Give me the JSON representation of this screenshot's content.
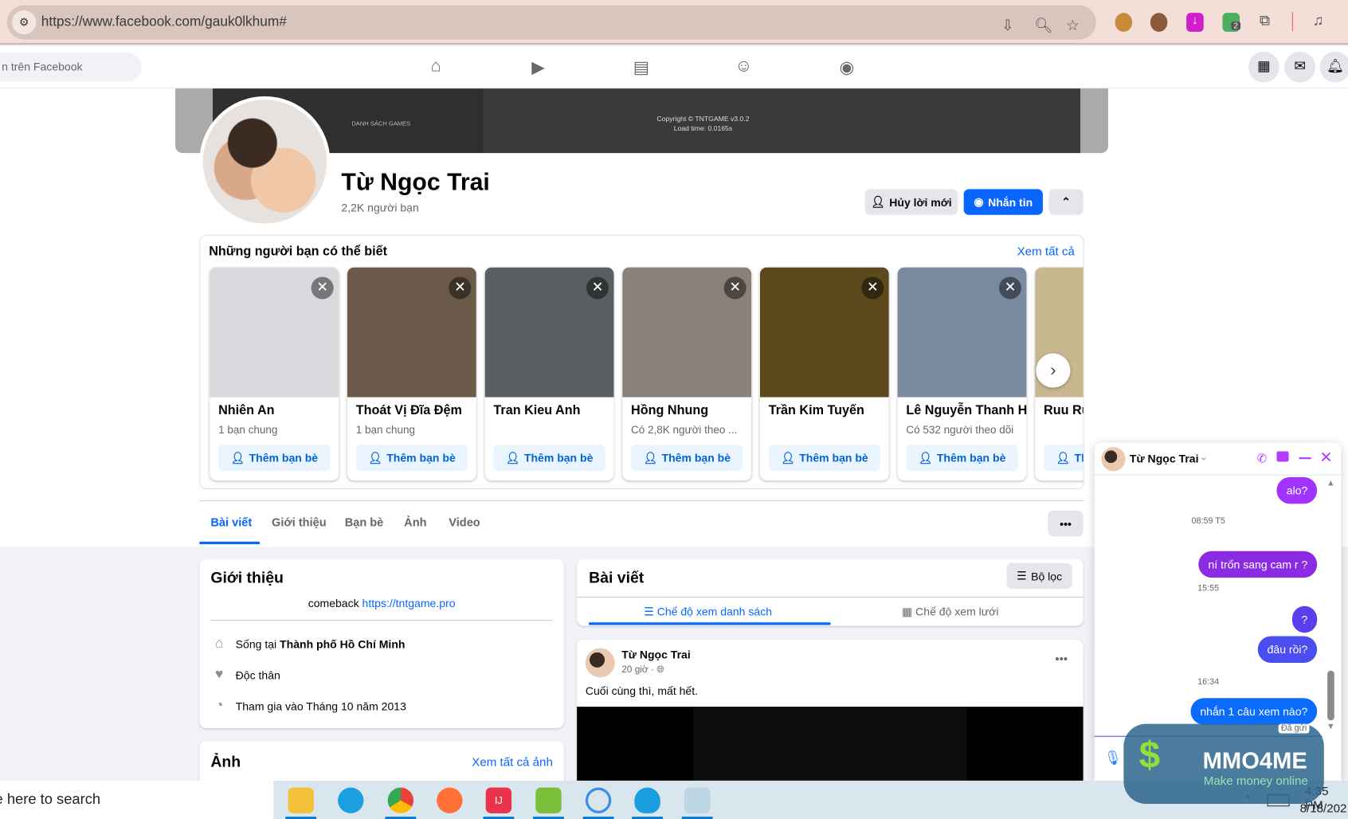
{
  "browser": {
    "url": "https://www.facebook.com/gauk0lkhum#",
    "ext_badge": "2"
  },
  "fb_nav": {
    "search_placeholder": "n trên Facebook"
  },
  "cover": {
    "copyright": "Copyright © TNTGAME v3.0.2",
    "load_time": "Load time: 0.0165s",
    "games_list": "DANH SÁCH GAMES"
  },
  "profile": {
    "name": "Từ Ngọc Trai",
    "friends": "2,2K người bạn",
    "cancel_request": "Hủy lời mới",
    "message": "Nhắn tin"
  },
  "suggestions": {
    "title": "Những người bạn có thể biết",
    "see_all": "Xem tất cả",
    "add_label": "Thêm bạn bè",
    "people": [
      {
        "name": "Nhiên An",
        "meta": "1 bạn chung",
        "color": "#d9d9dd"
      },
      {
        "name": "Thoát Vị Đĩa Đệm",
        "meta": "1 bạn chung",
        "color": "#6b5a4a"
      },
      {
        "name": "Tran Kieu Anh",
        "meta": "",
        "color": "#5a6061"
      },
      {
        "name": "Hồng Nhung",
        "meta": "Có 2,8K người theo ...",
        "color": "#8a8078"
      },
      {
        "name": "Trần Kim Tuyến",
        "meta": "",
        "color": "#5c4a1e"
      },
      {
        "name": "Lê Nguyễn Thanh H",
        "meta": "Có 532 người theo dõi",
        "color": "#7a8aa0"
      },
      {
        "name": "Ruu Ru",
        "meta": "",
        "color": "#c8b890"
      }
    ]
  },
  "tabs": [
    "Bài viết",
    "Giới thiệu",
    "Bạn bè",
    "Ảnh",
    "Video"
  ],
  "intro": {
    "title": "Giới thiệu",
    "bio_prefix": "comeback",
    "bio_link": "https://tntgame.pro",
    "lives_prefix": "Sống tại",
    "lives_city": "Thành phố Hồ Chí Minh",
    "relationship": "Độc thân",
    "joined": "Tham gia vào Tháng 10 năm 2013"
  },
  "photos": {
    "title": "Ảnh",
    "see_all": "Xem tất cả ảnh"
  },
  "posts": {
    "title": "Bài viết",
    "filter": "Bộ lọc",
    "list_view": "Chế độ xem danh sách",
    "grid_view": "Chế độ xem lưới"
  },
  "post": {
    "author": "Từ Ngọc Trai",
    "time": "20 giờ ·",
    "text": "Cuối cùng thì, mất hết."
  },
  "chat": {
    "name": "Từ Ngọc Trai",
    "messages": [
      {
        "type": "msg",
        "text": "alo?",
        "color": "#a033ff"
      },
      {
        "type": "time",
        "text": "08:59 T5"
      },
      {
        "type": "msg",
        "text": "ní trốn sang cam r ?",
        "color": "#8a2be2"
      },
      {
        "type": "time",
        "text": "15:55"
      },
      {
        "type": "msg",
        "text": "?",
        "color": "#5b3fef"
      },
      {
        "type": "msg",
        "text": "đâu rồi?",
        "color": "#4a4ef0"
      },
      {
        "type": "time",
        "text": "16:34"
      },
      {
        "type": "msg",
        "text": "nhắn 1 câu xem nào?",
        "color": "#0a6cff"
      }
    ],
    "status": "Đã gửi"
  },
  "taskbar": {
    "search": "e here to search",
    "time": "4:35 PM",
    "date": "8/18/202"
  },
  "watermark": {
    "brand": "MMO4ME",
    "tagline": "Make money online"
  }
}
